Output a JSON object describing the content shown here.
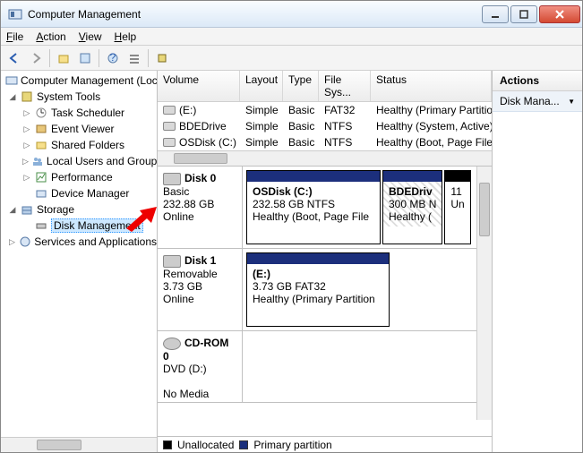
{
  "window": {
    "title": "Computer Management"
  },
  "menu": {
    "file": "File",
    "action": "Action",
    "view": "View",
    "help": "Help"
  },
  "tree": {
    "root": "Computer Management (Local)",
    "system_tools": "System Tools",
    "task_scheduler": "Task Scheduler",
    "event_viewer": "Event Viewer",
    "shared_folders": "Shared Folders",
    "local_users": "Local Users and Groups",
    "performance": "Performance",
    "device_manager": "Device Manager",
    "storage": "Storage",
    "disk_management": "Disk Management",
    "services": "Services and Applications"
  },
  "vol_cols": {
    "volume": "Volume",
    "layout": "Layout",
    "type": "Type",
    "fs": "File Sys...",
    "status": "Status"
  },
  "volumes": [
    {
      "name": "(E:)",
      "layout": "Simple",
      "type": "Basic",
      "fs": "FAT32",
      "status": "Healthy (Primary Partition)"
    },
    {
      "name": "BDEDrive",
      "layout": "Simple",
      "type": "Basic",
      "fs": "NTFS",
      "status": "Healthy (System, Active)"
    },
    {
      "name": "OSDisk (C:)",
      "layout": "Simple",
      "type": "Basic",
      "fs": "NTFS",
      "status": "Healthy (Boot, Page File)"
    }
  ],
  "disk0": {
    "name": "Disk 0",
    "type": "Basic",
    "size": "232.88 GB",
    "status": "Online",
    "p1_name": "OSDisk  (C:)",
    "p1_line2": "232.58 GB NTFS",
    "p1_line3": "Healthy (Boot, Page File",
    "p2_name": "BDEDriv",
    "p2_line2": "300 MB N",
    "p2_line3": "Healthy (",
    "p3_line2": "11",
    "p3_line3": "Un"
  },
  "disk1": {
    "name": "Disk 1",
    "type": "Removable",
    "size": "3.73 GB",
    "status": "Online",
    "p1_name": "(E:)",
    "p1_line2": "3.73 GB FAT32",
    "p1_line3": "Healthy (Primary Partition"
  },
  "cd0": {
    "name": "CD-ROM 0",
    "type": "DVD (D:)",
    "status": "No Media"
  },
  "legend": {
    "unallocated": "Unallocated",
    "primary": "Primary partition"
  },
  "actions": {
    "head": "Actions",
    "item": "Disk Mana..."
  }
}
